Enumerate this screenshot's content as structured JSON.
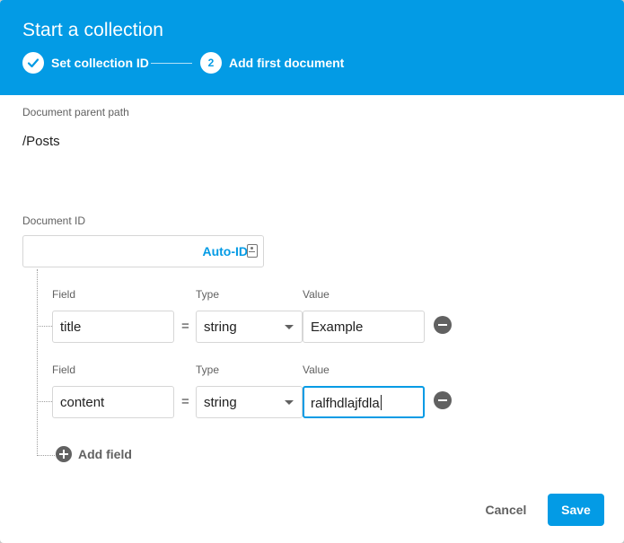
{
  "dialog": {
    "title": "Start a collection",
    "steps": [
      {
        "number": "1",
        "label": "Set collection ID",
        "completed": true
      },
      {
        "number": "2",
        "label": "Add first document",
        "completed": false
      }
    ]
  },
  "parent_path": {
    "label": "Document parent path",
    "value": "/Posts"
  },
  "document_id": {
    "label": "Document ID",
    "value": "",
    "auto_id_label": "Auto-ID"
  },
  "fields": [
    {
      "field_label": "Field",
      "type_label": "Type",
      "value_label": "Value",
      "name": "title",
      "type": "string",
      "value": "Example",
      "focused": false
    },
    {
      "field_label": "Field",
      "type_label": "Type",
      "value_label": "Value",
      "name": "content",
      "type": "string",
      "value": "ralfhdlajfdla",
      "focused": true
    }
  ],
  "equals_sign": "=",
  "add_field_label": "Add field",
  "actions": {
    "cancel_label": "Cancel",
    "save_label": "Save"
  },
  "colors": {
    "primary": "#039be5",
    "text": "#212121",
    "muted": "#616161"
  }
}
